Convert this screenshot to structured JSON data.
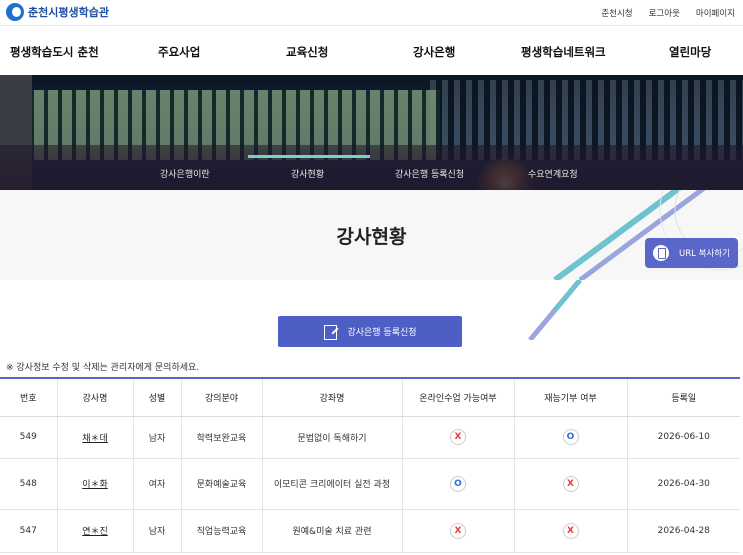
{
  "brand": {
    "logo_text": "춘천시평생학습관"
  },
  "util_links": [
    "춘천시청",
    "로그아웃",
    "마이페이지"
  ],
  "main_nav": [
    "평생학습도시 춘천",
    "주요사업",
    "교육신청",
    "강사은행",
    "평생학습네트워크",
    "열린마당"
  ],
  "sub_nav": {
    "items": [
      "강사은행이란",
      "강사현황",
      "강사은행 등록신청",
      "수요연계요청"
    ],
    "active": 1
  },
  "page": {
    "title": "강사현황"
  },
  "url_copy_label": "URL 복사하기",
  "register_button_label": "강사은행 등록신청",
  "notice": "※ 강사정보 수정 및 삭제는 관리자에게 문의하세요.",
  "table": {
    "headers": [
      "번호",
      "강사명",
      "성별",
      "강의분야",
      "강좌명",
      "온라인수업 가능여부",
      "재능기부 여부",
      "등록일"
    ],
    "rows": [
      {
        "no": "549",
        "name": "채＊데",
        "gender": "남자",
        "field": "학력보완교육",
        "course": "문법없이 독해하기",
        "online": "X",
        "donation": "O",
        "date": "2026-06-10"
      },
      {
        "no": "548",
        "name": "이＊화",
        "gender": "여자",
        "field": "문화예술교육",
        "course": "이모티콘 크리에이터 실전 과정",
        "online": "O",
        "donation": "X",
        "date": "2026-04-30"
      },
      {
        "no": "547",
        "name": "연＊진",
        "gender": "남자",
        "field": "직업능력교육",
        "course": "원예&미술 치료 관련",
        "online": "X",
        "donation": "X",
        "date": "2026-04-28"
      }
    ]
  },
  "colors": {
    "accent": "#4d5fc5",
    "table_top": "#5867c8",
    "x_mark": "#e04040",
    "o_mark": "#2a70c8",
    "active_tab": "#7bd1c6"
  }
}
